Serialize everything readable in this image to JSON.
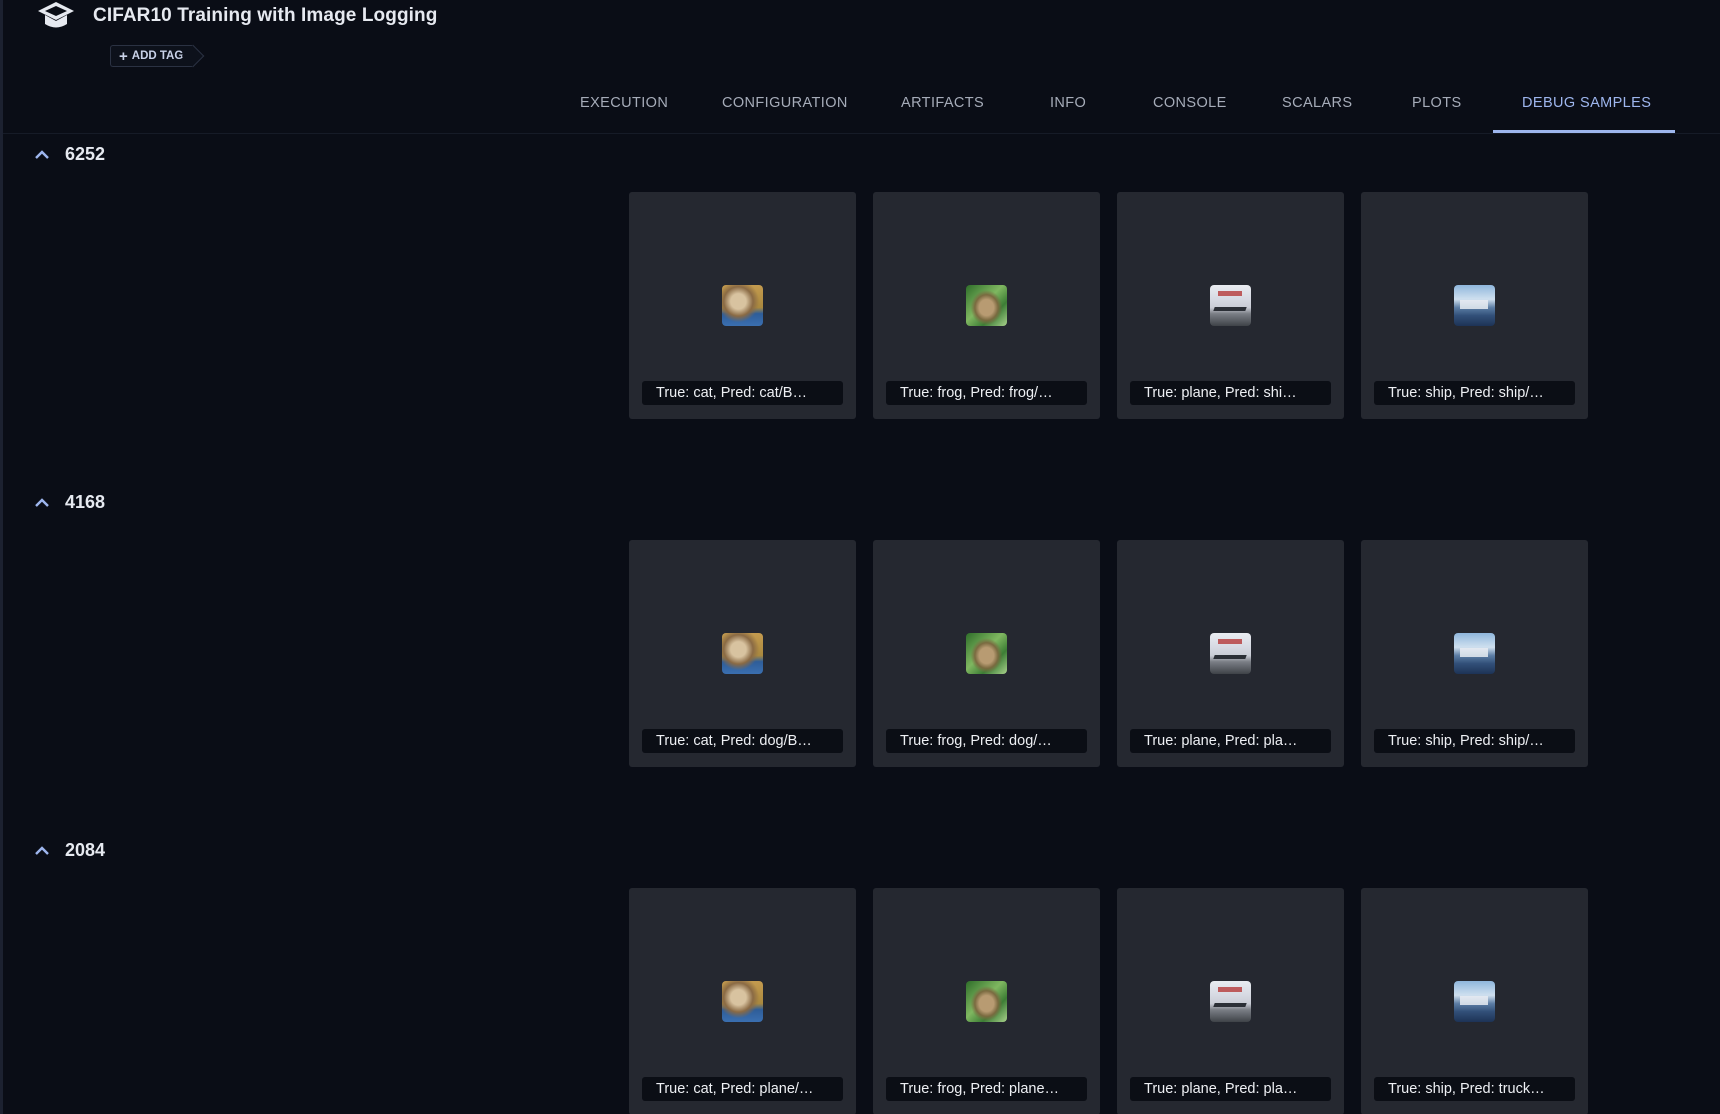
{
  "header": {
    "title": "CIFAR10 Training with Image Logging",
    "add_tag_label": "ADD TAG"
  },
  "tabs": [
    {
      "label": "EXECUTION",
      "active": false
    },
    {
      "label": "CONFIGURATION",
      "active": false
    },
    {
      "label": "ARTIFACTS",
      "active": false
    },
    {
      "label": "INFO",
      "active": false
    },
    {
      "label": "CONSOLE",
      "active": false
    },
    {
      "label": "SCALARS",
      "active": false
    },
    {
      "label": "PLOTS",
      "active": false
    },
    {
      "label": "DEBUG SAMPLES",
      "active": true
    }
  ],
  "colors": {
    "background": "#0a0d16",
    "card": "#252830",
    "accent": "#9eb6ee"
  },
  "iterations": [
    {
      "label": "6252",
      "samples": [
        {
          "caption": "True: cat, Pred: cat/B…",
          "thumbnail": "cat"
        },
        {
          "caption": "True: frog, Pred: frog/…",
          "thumbnail": "frog"
        },
        {
          "caption": "True: plane, Pred: shi…",
          "thumbnail": "plane"
        },
        {
          "caption": "True: ship, Pred: ship/…",
          "thumbnail": "ship"
        }
      ]
    },
    {
      "label": "4168",
      "samples": [
        {
          "caption": "True: cat, Pred: dog/B…",
          "thumbnail": "cat"
        },
        {
          "caption": "True: frog, Pred: dog/…",
          "thumbnail": "frog"
        },
        {
          "caption": "True: plane, Pred: pla…",
          "thumbnail": "plane"
        },
        {
          "caption": "True: ship, Pred: ship/…",
          "thumbnail": "ship"
        }
      ]
    },
    {
      "label": "2084",
      "samples": [
        {
          "caption": "True: cat, Pred: plane/…",
          "thumbnail": "cat"
        },
        {
          "caption": "True: frog, Pred: plane…",
          "thumbnail": "frog"
        },
        {
          "caption": "True: plane, Pred: pla…",
          "thumbnail": "plane"
        },
        {
          "caption": "True: ship, Pred: truck…",
          "thumbnail": "ship"
        }
      ]
    }
  ]
}
